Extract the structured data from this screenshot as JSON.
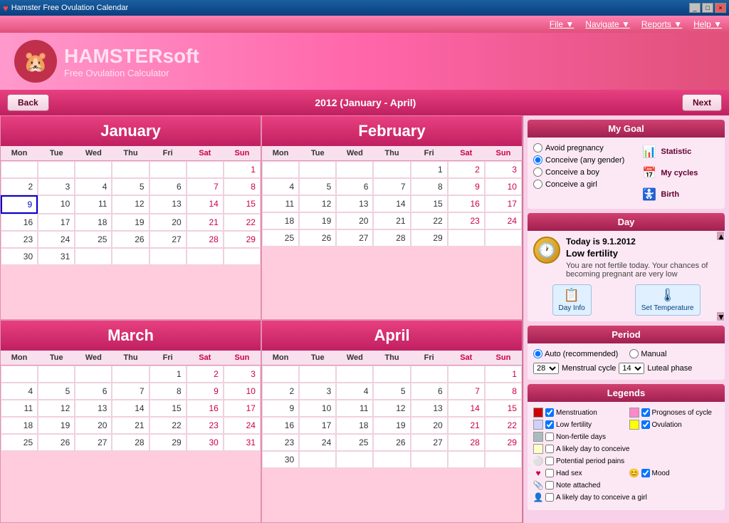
{
  "titleBar": {
    "title": "Hamster Free Ovulation Calendar",
    "icon": "♥",
    "controls": [
      "_",
      "□",
      "×"
    ]
  },
  "menuBar": {
    "items": [
      "File ▼",
      "Navigate ▼",
      "Reports ▼",
      "Help ▼"
    ]
  },
  "header": {
    "appName": "HAMSTER",
    "appNameSuffix": "soft",
    "subtitle": "Free Ovulation Calculator"
  },
  "nav": {
    "back": "Back",
    "title": "2012 (January - April)",
    "next": "Next"
  },
  "myGoal": {
    "sectionTitle": "My Goal",
    "options": [
      {
        "label": "Avoid pregnancy",
        "checked": false
      },
      {
        "label": "Conceive (any gender)",
        "checked": true
      },
      {
        "label": "Conceive a boy",
        "checked": false
      },
      {
        "label": "Conceive a girl",
        "checked": false
      }
    ],
    "actions": [
      {
        "label": "Statistic",
        "icon": "📊"
      },
      {
        "label": "My cycles",
        "icon": "📅"
      },
      {
        "label": "Birth",
        "icon": "🚼"
      }
    ]
  },
  "day": {
    "sectionTitle": "Day",
    "today": "Today is 9.1.2012",
    "status": "Low fertility",
    "description": "You are not fertile today. Your chances of becoming pregnant are very low",
    "buttons": [
      {
        "label": "Day Info",
        "icon": "📋"
      },
      {
        "label": "Set Temperature",
        "icon": "🌡"
      }
    ]
  },
  "period": {
    "sectionTitle": "Period",
    "auto": "Auto (recommended)",
    "manual": "Manual",
    "cycleLength": "28",
    "menstrualLabel": "Menstrual cycle",
    "lutealLength": "14",
    "lutealLabel": "Luteal phase"
  },
  "legends": {
    "sectionTitle": "Legends",
    "items": [
      {
        "color": "#cc0000",
        "hasCheck": true,
        "label": "Menstruation",
        "color2": "#ff88cc",
        "hasCheck2": true,
        "label2": "Prognoses of cycle"
      },
      {
        "color": "#ccccff",
        "hasCheck": true,
        "label": "Low fertility",
        "color2": "#ffff00",
        "hasCheck2": true,
        "label2": "Ovulation"
      },
      {
        "color": "#aabbcc",
        "hasCheck": false,
        "label": "Non-fertile days"
      },
      {
        "color": "#ffffaa",
        "hasCheck": false,
        "label": "A likely day to conceive"
      },
      {
        "icon": "⚪",
        "hasCheck": false,
        "label": "Potential period pains"
      },
      {
        "icon": "♥",
        "hasCheck": false,
        "label": "Had sex",
        "icon2": "😊",
        "hasCheck2": true,
        "label2": "Mood"
      },
      {
        "icon": "📎",
        "hasCheck": false,
        "label": "Note attached"
      },
      {
        "icon": "👤",
        "hasCheck": false,
        "label": "A likely day to conceive a girl"
      }
    ]
  },
  "months": [
    {
      "name": "January",
      "days": [
        {
          "d": null
        },
        {
          "d": null
        },
        {
          "d": null
        },
        {
          "d": null
        },
        {
          "d": null
        },
        {
          "d": null,
          "sat": true
        },
        {
          "d": 1,
          "sun": true
        },
        {
          "d": 2
        },
        {
          "d": 3
        },
        {
          "d": 4
        },
        {
          "d": 5
        },
        {
          "d": 6
        },
        {
          "d": 7,
          "sat": true
        },
        {
          "d": 8,
          "sun": true
        },
        {
          "d": 9,
          "today": true
        },
        {
          "d": 10
        },
        {
          "d": 11
        },
        {
          "d": 12
        },
        {
          "d": 13
        },
        {
          "d": 14,
          "sat": true
        },
        {
          "d": 15,
          "sun": true
        },
        {
          "d": 16
        },
        {
          "d": 17
        },
        {
          "d": 18
        },
        {
          "d": 19
        },
        {
          "d": 20
        },
        {
          "d": 21,
          "sat": true
        },
        {
          "d": 22,
          "sun": true
        },
        {
          "d": 23
        },
        {
          "d": 24
        },
        {
          "d": 25
        },
        {
          "d": 26
        },
        {
          "d": 27
        },
        {
          "d": 28,
          "sat": true
        },
        {
          "d": 29,
          "sun": true
        },
        {
          "d": 30
        },
        {
          "d": 31
        },
        {
          "d": null
        },
        {
          "d": null
        },
        {
          "d": null
        },
        {
          "d": null
        },
        {
          "d": null
        }
      ]
    },
    {
      "name": "February",
      "days": [
        {
          "d": null
        },
        {
          "d": null
        },
        {
          "d": null
        },
        {
          "d": null
        },
        {
          "d": 1
        },
        {
          "d": 2,
          "sat": true
        },
        {
          "d": 3,
          "sun": true
        },
        {
          "d": 4
        },
        {
          "d": 5
        },
        {
          "d": 6
        },
        {
          "d": 7
        },
        {
          "d": 8
        },
        {
          "d": 9,
          "sat": true
        },
        {
          "d": 10,
          "sun": true
        },
        {
          "d": 11
        },
        {
          "d": 12
        },
        {
          "d": 13
        },
        {
          "d": 14
        },
        {
          "d": 15
        },
        {
          "d": 16,
          "sat": true
        },
        {
          "d": 17,
          "sun": true
        },
        {
          "d": 18
        },
        {
          "d": 19
        },
        {
          "d": 20
        },
        {
          "d": 21
        },
        {
          "d": 22
        },
        {
          "d": 23,
          "sat": true
        },
        {
          "d": 24,
          "sun": true
        },
        {
          "d": 25
        },
        {
          "d": 26
        },
        {
          "d": 27
        },
        {
          "d": 28
        },
        {
          "d": 29
        },
        {
          "d": null,
          "sat": true
        },
        {
          "d": null,
          "sun": true
        }
      ]
    },
    {
      "name": "March",
      "days": [
        {
          "d": null
        },
        {
          "d": null
        },
        {
          "d": null
        },
        {
          "d": null
        },
        {
          "d": 1
        },
        {
          "d": 2,
          "sat": true
        },
        {
          "d": 3,
          "sun": true
        },
        {
          "d": 4
        },
        {
          "d": 5
        },
        {
          "d": 6
        },
        {
          "d": 7
        },
        {
          "d": 8
        },
        {
          "d": 9,
          "sat": true
        },
        {
          "d": 10,
          "sun": true
        },
        {
          "d": 11
        },
        {
          "d": 12
        },
        {
          "d": 13
        },
        {
          "d": 14
        },
        {
          "d": 15
        },
        {
          "d": 16,
          "sat": true
        },
        {
          "d": 17,
          "sun": true
        },
        {
          "d": 18
        },
        {
          "d": 19
        },
        {
          "d": 20
        },
        {
          "d": 21
        },
        {
          "d": 22
        },
        {
          "d": 23,
          "sat": true
        },
        {
          "d": 24,
          "sun": true
        },
        {
          "d": 25
        },
        {
          "d": 26
        },
        {
          "d": 27
        },
        {
          "d": 28
        },
        {
          "d": 29
        },
        {
          "d": 30,
          "sat": true
        },
        {
          "d": 31,
          "sun": true
        }
      ]
    },
    {
      "name": "April",
      "days": [
        {
          "d": null
        },
        {
          "d": null
        },
        {
          "d": null
        },
        {
          "d": null
        },
        {
          "d": null
        },
        {
          "d": null,
          "sat": true
        },
        {
          "d": 1,
          "sun": true
        },
        {
          "d": 2
        },
        {
          "d": 3
        },
        {
          "d": 4
        },
        {
          "d": 5
        },
        {
          "d": 6
        },
        {
          "d": 7,
          "sat": true
        },
        {
          "d": 8,
          "sun": true
        },
        {
          "d": 9
        },
        {
          "d": 10
        },
        {
          "d": 11
        },
        {
          "d": 12
        },
        {
          "d": 13
        },
        {
          "d": 14,
          "sat": true
        },
        {
          "d": 15,
          "sun": true
        },
        {
          "d": 16
        },
        {
          "d": 17
        },
        {
          "d": 18
        },
        {
          "d": 19
        },
        {
          "d": 20
        },
        {
          "d": 21,
          "sat": true
        },
        {
          "d": 22,
          "sun": true
        },
        {
          "d": 23
        },
        {
          "d": 24
        },
        {
          "d": 25
        },
        {
          "d": 26
        },
        {
          "d": 27
        },
        {
          "d": 28,
          "sat": true
        },
        {
          "d": 29,
          "sun": true
        },
        {
          "d": 30
        },
        {
          "d": null
        },
        {
          "d": null
        },
        {
          "d": null
        },
        {
          "d": null
        },
        {
          "d": null
        },
        {
          "d": null
        }
      ]
    }
  ],
  "dayHeaders": [
    "Mon",
    "Tue",
    "Wed",
    "Thu",
    "Fri",
    "Sat",
    "Sun"
  ]
}
